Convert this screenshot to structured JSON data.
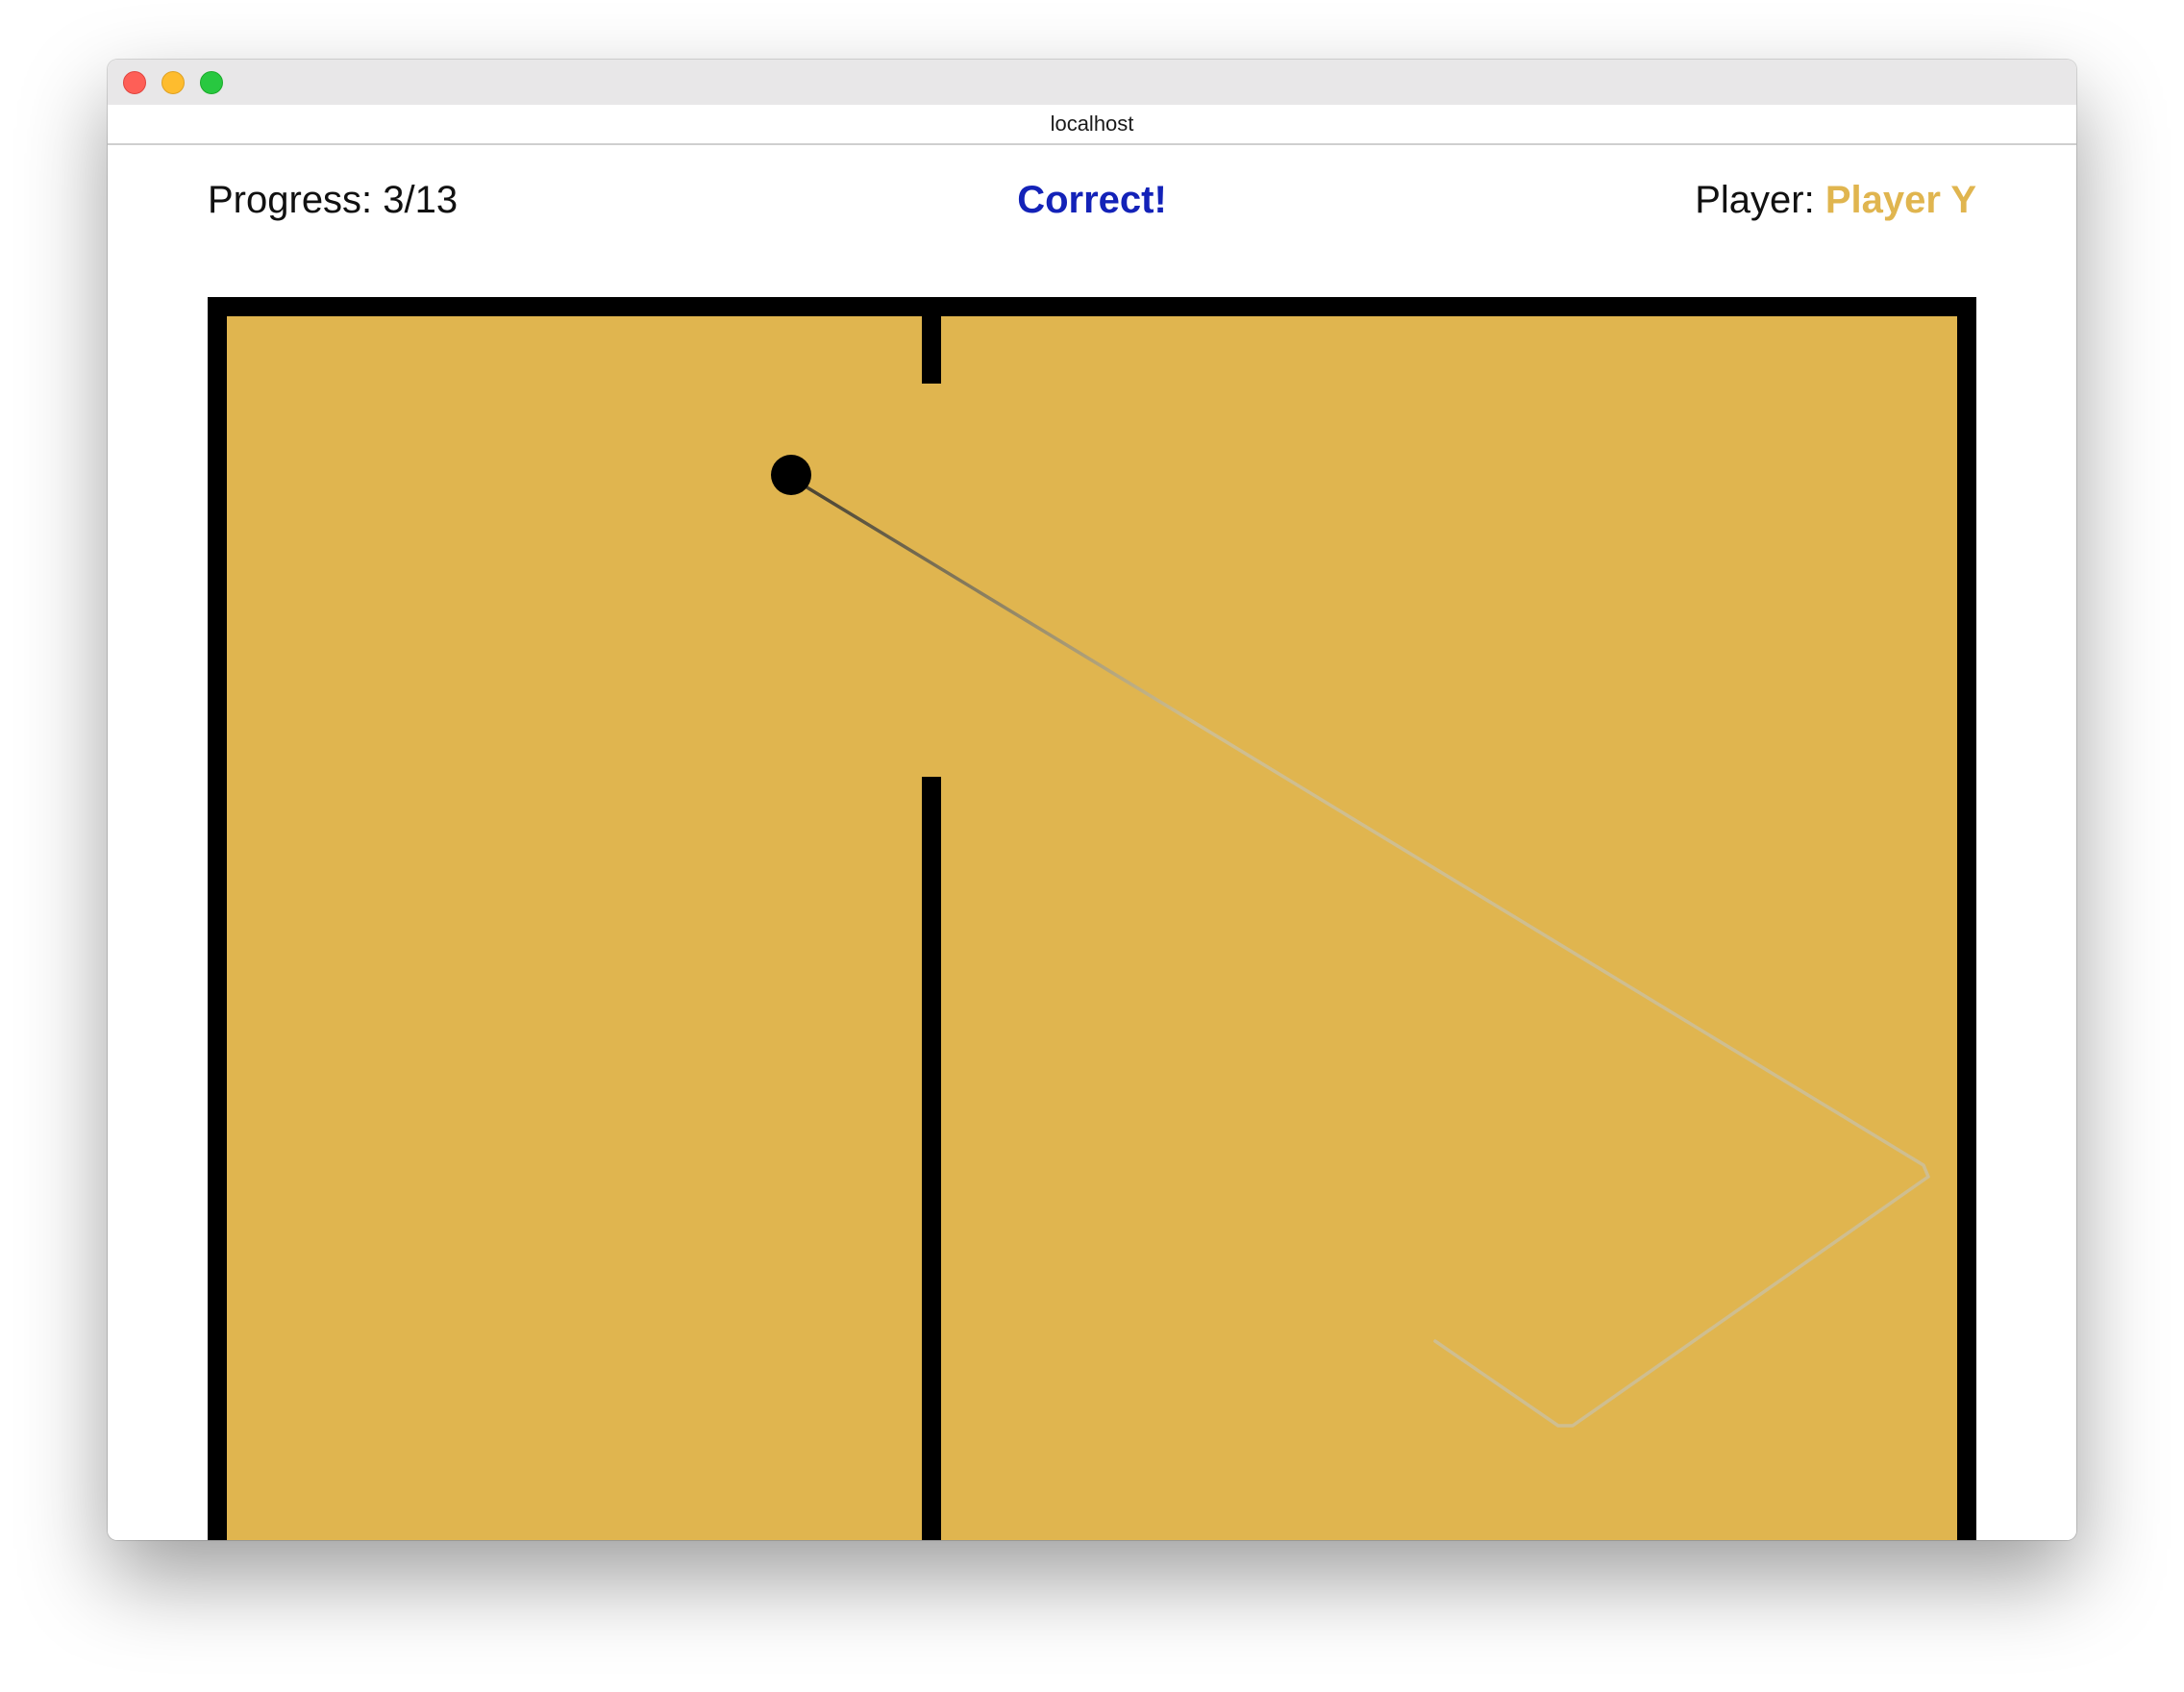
{
  "browser": {
    "url": "localhost"
  },
  "game": {
    "progress": "Progress: 3/13",
    "feedback": "Correct!",
    "player_label": "Player: ",
    "player_name": "Player Y"
  },
  "colors": {
    "maze_floor": "#e0b54f",
    "walls": "#000000",
    "ball": "#000000",
    "feedback": "#1322b8",
    "player_name": "#e0b54f"
  },
  "icons": {
    "close": "red-circle",
    "minimize": "yellow-circle",
    "maximize": "green-circle"
  }
}
